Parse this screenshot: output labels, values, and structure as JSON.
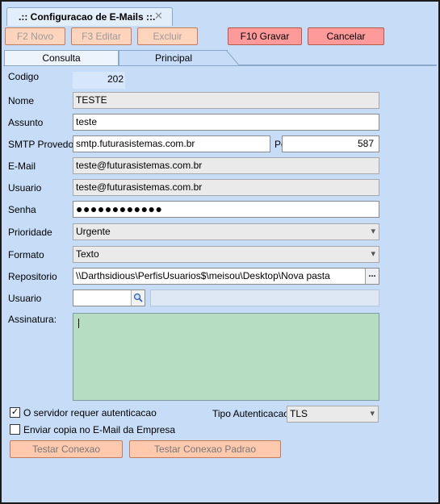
{
  "window": {
    "tab_title": ".:: Configuracao de E-Mails ::.",
    "close_glyph": "✕"
  },
  "toolbar": {
    "new_label": "F2 Novo",
    "edit_label": "F3 Editar",
    "delete_label": "Excluir",
    "save_label": "F10 Gravar",
    "cancel_label": "Cancelar"
  },
  "tabs": {
    "consulta": "Consulta",
    "principal": "Principal"
  },
  "form": {
    "codigo": {
      "label": "Codigo",
      "value": "202"
    },
    "nome": {
      "label": "Nome",
      "value": "TESTE"
    },
    "assunto": {
      "label": "Assunto",
      "value": "teste"
    },
    "smtp": {
      "label": "SMTP Provedor",
      "value": "smtp.futurasistemas.com.br"
    },
    "porta": {
      "label": "Porta",
      "value": "587"
    },
    "email": {
      "label": "E-Mail",
      "value": "teste@futurasistemas.com.br"
    },
    "usuario": {
      "label": "Usuario",
      "value": "teste@futurasistemas.com.br"
    },
    "senha": {
      "label": "Senha",
      "value": "●●●●●●●●●●●●"
    },
    "prioridade": {
      "label": "Prioridade",
      "value": "Urgente"
    },
    "formato": {
      "label": "Formato",
      "value": "Texto"
    },
    "repositorio": {
      "label": "Repositorio",
      "value": "\\\\Darthsidious\\PerfisUsuarios$\\meisou\\Desktop\\Nova pasta",
      "button": "..."
    },
    "usuario_lookup": {
      "label": "Usuario",
      "value": "",
      "description": ""
    },
    "assinatura": {
      "label": "Assinatura:",
      "value": ""
    },
    "requer_autenticacao": {
      "label": "O servidor requer autenticacao",
      "checked": true
    },
    "enviar_copia": {
      "label": "Enviar copia no E-Mail da Empresa",
      "checked": false
    },
    "tipo_autenticacao": {
      "label": "Tipo Autenticacao",
      "value": "TLS"
    }
  },
  "actions": {
    "test_connection": "Testar Conexao",
    "test_default_connection": "Testar Conexao Padrao"
  },
  "icons": {
    "dropdown": "▾",
    "check": "✓"
  },
  "colors": {
    "background": "#c6dcf7",
    "button_disabled": "#ffd4bc",
    "button_active": "#ff9a9a",
    "memo": "#b6dcc1"
  }
}
